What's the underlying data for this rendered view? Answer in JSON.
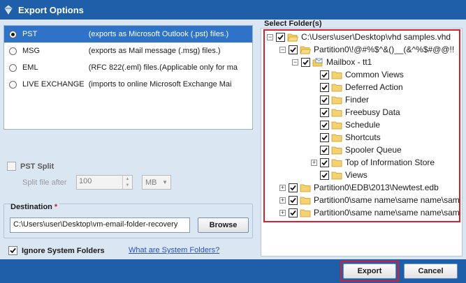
{
  "window": {
    "title": "Export Options"
  },
  "options": [
    {
      "name": "PST",
      "desc": "(exports as Microsoft Outlook (.pst) files.)",
      "selected": true
    },
    {
      "name": "MSG",
      "desc": "(exports as Mail message (.msg) files.)",
      "selected": false
    },
    {
      "name": "EML",
      "desc": "(RFC 822(.eml) files.(Applicable only for ma",
      "selected": false
    },
    {
      "name": "LIVE EXCHANGE",
      "desc": "(imports to online Microsoft Exchange Mai",
      "selected": false
    }
  ],
  "pst_split": {
    "label": "PST Split",
    "checked": false,
    "split_label": "Split file after",
    "value": "100",
    "unit": "MB"
  },
  "destination": {
    "label": "Destination",
    "required_mark": "*",
    "path": "C:\\Users\\user\\Desktop\\vm-email-folder-recovery",
    "browse_label": "Browse"
  },
  "ignore": {
    "label": "Ignore System Folders",
    "checked": true,
    "link": "What are System Folders?"
  },
  "tree": {
    "label": "Select Folder(s)",
    "root": "C:\\Users\\user\\Desktop\\vhd samples.vhd",
    "partition1": "Partition0\\!@#%$^&()__(&^%$#@@!!",
    "mailbox": "Mailbox - tt1",
    "folders": [
      "Common Views",
      "Deferred Action",
      "Finder",
      "Freebusy Data",
      "Schedule",
      "Shortcuts",
      "Spooler Queue",
      "Top of Information Store",
      "Views"
    ],
    "partition2": "Partition0\\EDB\\2013\\Newtest.edb",
    "partition3": "Partition0\\same name\\same name\\same na",
    "partition4": "Partition0\\same name\\same name\\same na"
  },
  "buttons": {
    "export": "Export",
    "cancel": "Cancel"
  },
  "colors": {
    "titlebar": "#1f5ea8",
    "selection": "#2f73c9",
    "highlight_border": "#d4202f",
    "link": "#2750c8"
  }
}
